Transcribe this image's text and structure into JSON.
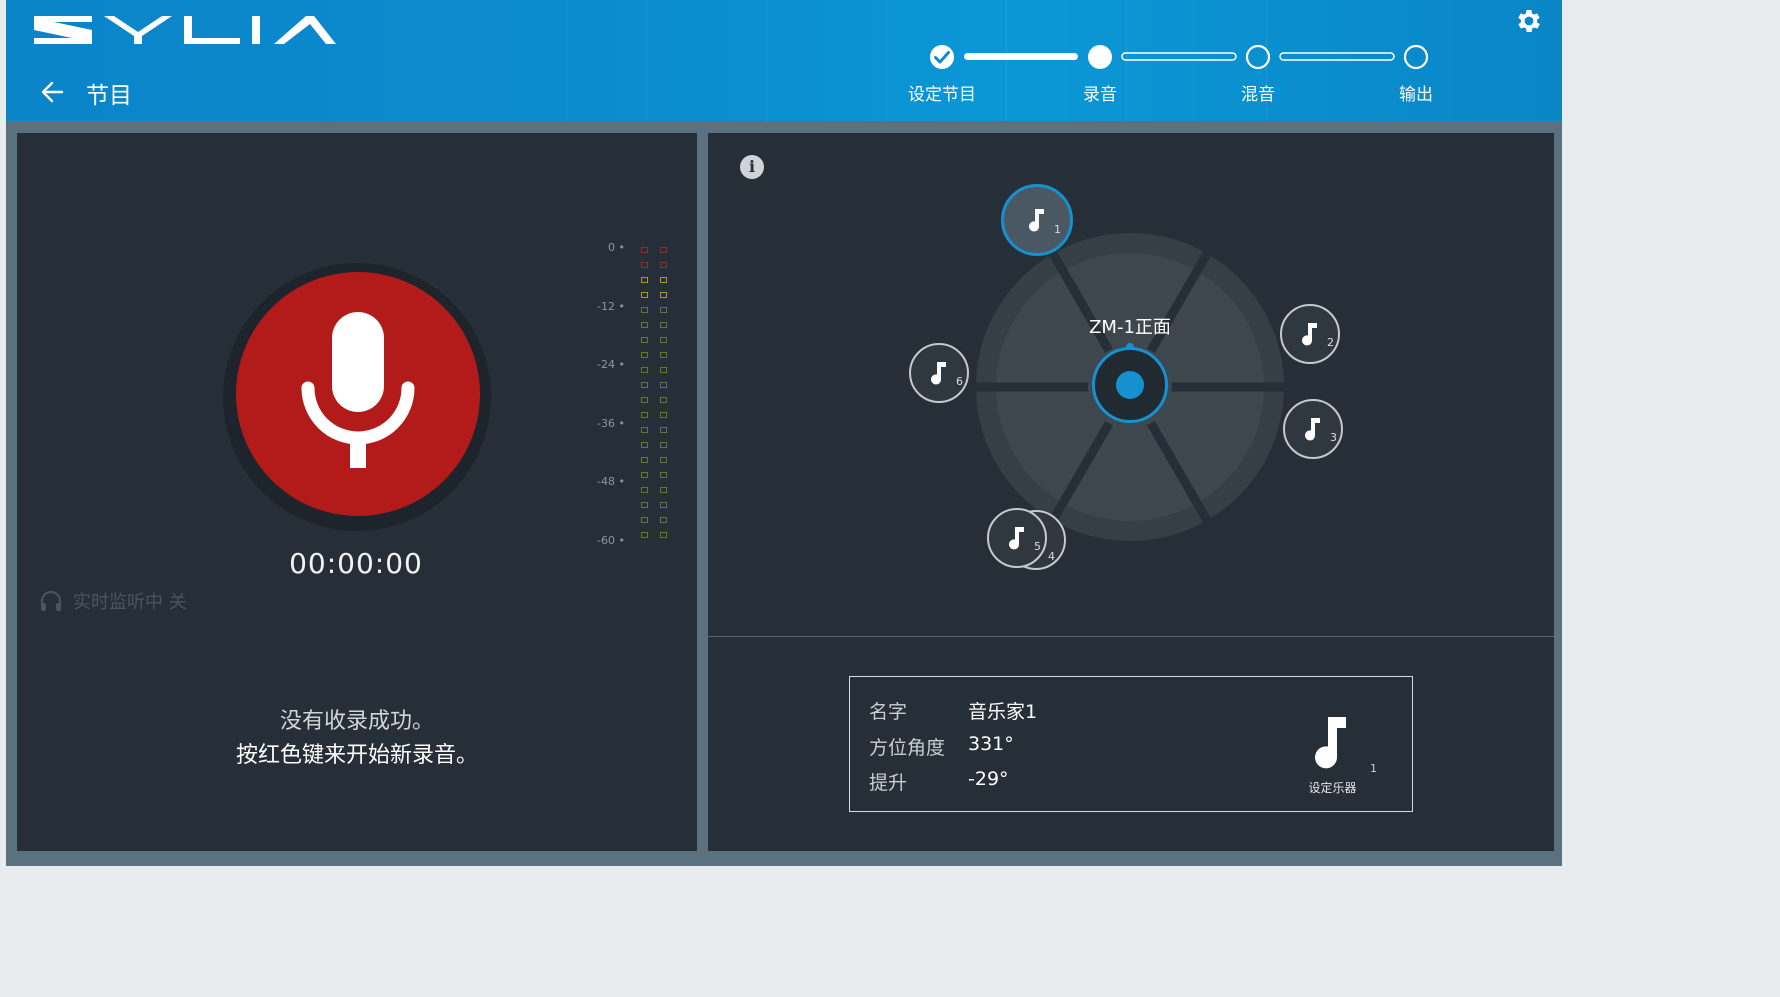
{
  "app": {
    "name": "ZYLIA"
  },
  "header": {
    "breadcrumb": "节目",
    "steps": [
      {
        "label": "设定节目",
        "state": "done"
      },
      {
        "label": "录音",
        "state": "current"
      },
      {
        "label": "混音",
        "state": "todo"
      },
      {
        "label": "输出",
        "state": "todo"
      }
    ]
  },
  "recorder": {
    "timer": "00:00:00",
    "monitoring": "实时监听中 关",
    "message_line1": "没有收录成功。",
    "message_line2": "按红色键来开始新录音。",
    "record_color": "#b31b1b"
  },
  "meter": {
    "db_labels": [
      "0",
      "-12",
      "-24",
      "-36",
      "-48",
      "-60"
    ],
    "channels": 2,
    "level": 0
  },
  "space": {
    "mic_label": "ZM-1正面",
    "sources": [
      {
        "num": "1",
        "selected": true
      },
      {
        "num": "2",
        "selected": false
      },
      {
        "num": "3",
        "selected": false
      },
      {
        "num": "4",
        "selected": false
      },
      {
        "num": "5",
        "selected": false
      },
      {
        "num": "6",
        "selected": false
      }
    ]
  },
  "details": {
    "name_label": "名字",
    "name_value": "音乐家1",
    "azimuth_label": "方位角度",
    "azimuth_value": "331°",
    "elevation_label": "提升",
    "elevation_value": "-29°",
    "instrument_num": "1",
    "instrument_button": "设定乐器"
  },
  "colors": {
    "accent": "#1691d0",
    "header": "#0b8ed0",
    "panel": "#262f37"
  }
}
